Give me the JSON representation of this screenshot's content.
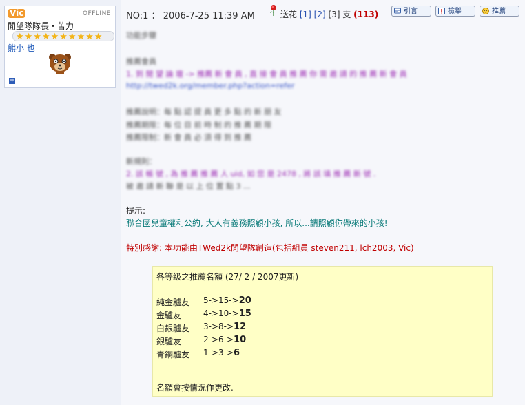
{
  "user": {
    "name": "Vic",
    "status": "OFFLINE",
    "title": "閒望隊隊長・苦力",
    "stars": "★★★★★★★★★★",
    "mood": "熊小 也",
    "expand": "+"
  },
  "post": {
    "number": "NO:1",
    "sep": "：",
    "datetime": "2006-7-25 11:39 AM",
    "flower_label": "送花",
    "flower_link_1": "[1]",
    "flower_link_2": "[2]",
    "flower_link_3": "[3]",
    "flower_unit": "支",
    "flower_count": "(113)",
    "buttons": {
      "quote": "引言",
      "report": "檢舉",
      "recommend": "推薦"
    }
  },
  "content": {
    "blurred": {
      "b1": "功能步驟",
      "b2": "推薦會員",
      "b3": "1. 到 閒 望 論 壇 -> 推薦 新 會 員 , 直 接 會 員 推 薦 你 需 邀 請 的 推 薦 新 會 員",
      "b4": "http://twed2k.org/member.php?action=refer",
      "b5": "推薦說明：每 點 認 提 員 更 多 點 的 新 朋 友",
      "b6": "推薦期限：每 位 目 前 時 制 的 推 薦 期 限",
      "b7": "推薦限制：新 會 員 必 須 得 到 推 薦",
      "b8": "新規則：",
      "b9": "2. 該 帳 號 , 為 推 薦 推 薦 人 uid, 如 您 是 2478 , 將 該 填 推 薦 新 號 .",
      "b10": "被 邀 請 新 聯 是 以 上 位 置 點 3 ..."
    },
    "hint_label": "提示:",
    "hint_text": "聯合國兒童權利公約, 大人有義務照顧小孩, 所以...請照顧你帶來的小孩!",
    "thanks": "特別感謝: 本功能由TWed2k閒望隊創造(包括組員 steven211, lch2003, Vic)"
  },
  "notice": {
    "header": "各等級之推薦名額 (27/ 2 / 2007更新)",
    "rows": [
      {
        "level": "純金驢友",
        "quota": "5->15->",
        "max": "20"
      },
      {
        "level": "金驢友",
        "quota": "4->10->",
        "max": "15"
      },
      {
        "level": "白銀驢友",
        "quota": "3->8->",
        "max": "12"
      },
      {
        "level": "銀驢友",
        "quota": "2->6->",
        "max": "10"
      },
      {
        "level": "青銅驢友",
        "quota": "1->3->",
        "max": "6"
      }
    ],
    "footer": "名額會按情況作更改."
  },
  "colors": {
    "hint": "#087a78",
    "thanks": "#c00000",
    "notice_bg": "#ffffc6",
    "accent": "#2a52b0"
  }
}
